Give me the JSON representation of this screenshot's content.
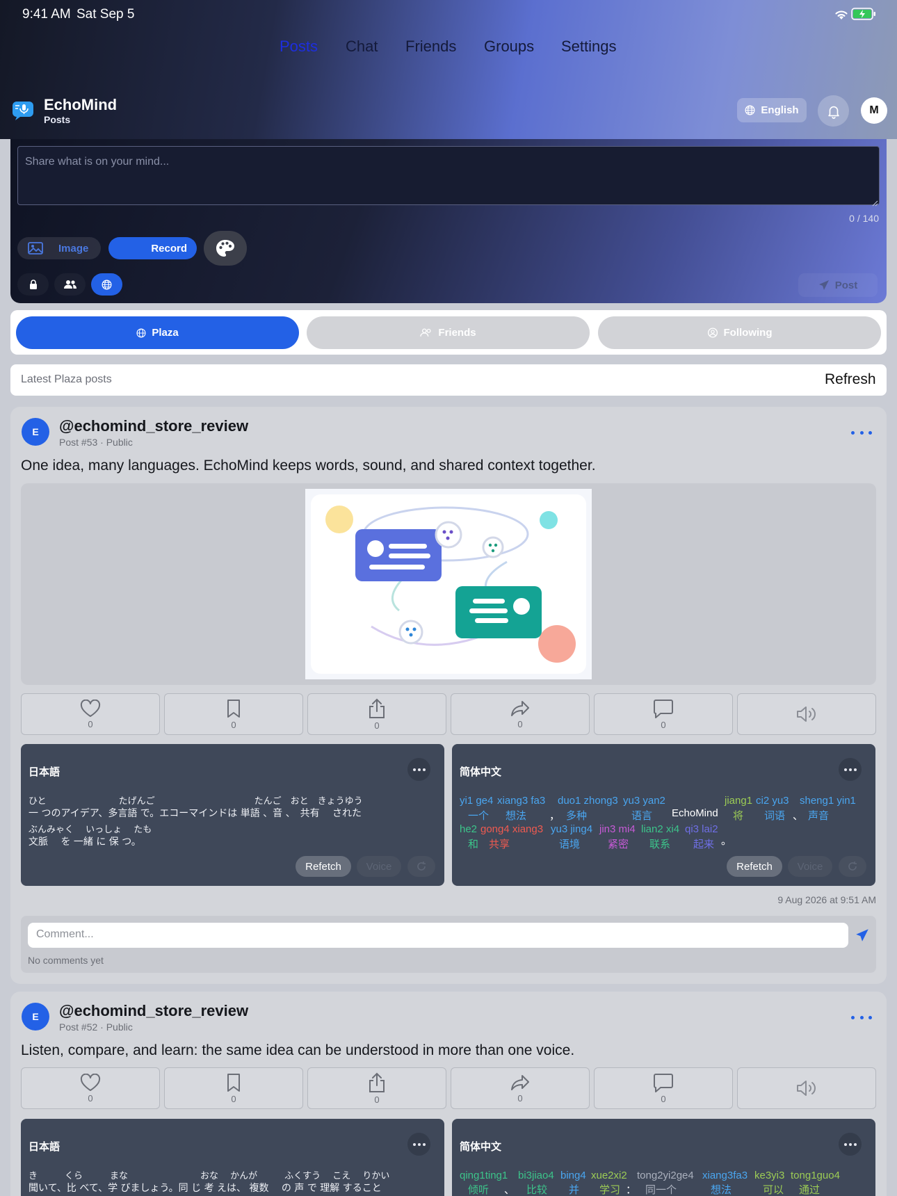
{
  "status": {
    "time": "9:41 AM",
    "date": "Sat Sep 5"
  },
  "nav": {
    "items": [
      "Posts",
      "Chat",
      "Friends",
      "Groups",
      "Settings"
    ],
    "active": "Posts"
  },
  "brand": {
    "title": "EchoMind",
    "subtitle": "Posts"
  },
  "header": {
    "language": "English",
    "avatar_initial": "M"
  },
  "composer": {
    "placeholder": "Share what is on your mind...",
    "counter": "0 / 140",
    "image_label": "Image",
    "record_label": "Record",
    "post_label": "Post",
    "visibility_selected": "public"
  },
  "feed_tabs": {
    "plaza": "Plaza",
    "friends": "Friends",
    "following": "Following",
    "active": "Plaza"
  },
  "feed_header": {
    "label": "Latest Plaza posts",
    "refresh": "Refresh"
  },
  "posts": [
    {
      "avatar_initial": "E",
      "handle": "@echomind_store_review",
      "meta": "Post #53 · Public",
      "text": "One idea, many languages. EchoMind keeps words, sound, and shared context together.",
      "counts": {
        "like": "0",
        "bookmark": "0",
        "share": "0",
        "forward": "0",
        "comment": "0"
      },
      "translations": {
        "ja": {
          "title": "日本語",
          "line1_reading": "ひと　　　　　　　　たげんご　　　　　　　　　　　たんご　おと　きょうゆう",
          "line1_text": "一 つのアイデア、多言語 で。エコーマインドは 単語 、音 、　共有 　された",
          "line2_reading": "ぶんみゃく　 いっしょ　 たも",
          "line2_text": "文脈 　を 一緒 に 保 つ。"
        },
        "zh": {
          "title": "简体中文",
          "brand_word": "EchoMind",
          "period": "。"
        }
      },
      "refetch": "Refetch",
      "voice": "Voice",
      "timestamp": "9 Aug 2026 at 9:51 AM",
      "comment_placeholder": "Comment...",
      "no_comments": "No comments yet"
    },
    {
      "avatar_initial": "E",
      "handle": "@echomind_store_review",
      "meta": "Post #52 · Public",
      "text": "Listen, compare, and learn: the same idea can be understood in more than one voice.",
      "counts": {
        "like": "0",
        "bookmark": "0",
        "share": "0",
        "forward": "0",
        "comment": "0"
      },
      "translations": {
        "ja": {
          "title": "日本語",
          "line1_reading": "き　　　くら　　　まな　　　　　　　　おな　 かんが　　　ふくすう　 こえ　 りかい",
          "line1_text": "聞いて、比 べて、学 びましょう。同 じ 考 えは、 複数 　の 声 で 理解 すること"
        },
        "zh": {
          "title": "简体中文"
        }
      }
    }
  ],
  "pinyin": {
    "p1_row1": [
      {
        "py": "yi1 ge4",
        "hz": "一个",
        "color": "#4aa6f0"
      },
      {
        "py": "xiang3 fa3",
        "hz": "想法",
        "color": "#4aa6f0"
      },
      {
        "py": "",
        "hz": "，",
        "color": "#ffffff"
      },
      {
        "py": "duo1 zhong3",
        "hz": "多种",
        "color": "#4aa6f0"
      },
      {
        "py": "yu3 yan2",
        "hz": "语言",
        "color": "#4aa6f0"
      },
      {
        "py": "jiang1",
        "hz": "将",
        "color": "#9ccc55"
      },
      {
        "py": "ci2 yu3",
        "hz": "词语",
        "color": "#4aa6f0"
      },
      {
        "py": "",
        "hz": "、",
        "color": "#ffffff"
      },
      {
        "py": "sheng1 yin1",
        "hz": "声音",
        "color": "#4aa6f0"
      }
    ],
    "p1_row2": [
      {
        "py": "he2",
        "hz": "和",
        "color": "#3cc48a"
      },
      {
        "py": "gong4 xiang3",
        "hz": "共享",
        "color": "#ef5a50"
      },
      {
        "py": "yu3 jing4",
        "hz": "语境",
        "color": "#4aa6f0"
      },
      {
        "py": "jin3 mi4",
        "hz": "紧密",
        "color": "#c75ad6"
      },
      {
        "py": "lian2 xi4",
        "hz": "联系",
        "color": "#3cc48a"
      },
      {
        "py": "qi3 lai2",
        "hz": "起来",
        "color": "#6f6fe6"
      }
    ],
    "p2_row1": [
      {
        "py": "qing1ting1",
        "hz": "倾听",
        "color": "#3cc48a"
      },
      {
        "py": "",
        "hz": "、",
        "color": "#ffffff"
      },
      {
        "py": "bi3jiao4",
        "hz": "比较",
        "color": "#3cc48a"
      },
      {
        "py": "bing4",
        "hz": "并",
        "color": "#4aa6f0"
      },
      {
        "py": "xue2xi2",
        "hz": "学习",
        "color": "#9ccc55"
      },
      {
        "py": "",
        "hz": "：",
        "color": "#ffffff"
      },
      {
        "py": "tong2yi2ge4",
        "hz": "同一个",
        "color": "#aab0bd"
      },
      {
        "py": "xiang3fa3",
        "hz": "想法",
        "color": "#4aa6f0"
      },
      {
        "py": "ke3yi3",
        "hz": "可以",
        "color": "#9ccc55"
      },
      {
        "py": "tong1guo4",
        "hz": "通过",
        "color": "#9ccc55"
      }
    ]
  },
  "colors": {
    "accent": "#2361e6",
    "card_bg": "#d3d5da",
    "translation_bg": "#3f4859"
  }
}
